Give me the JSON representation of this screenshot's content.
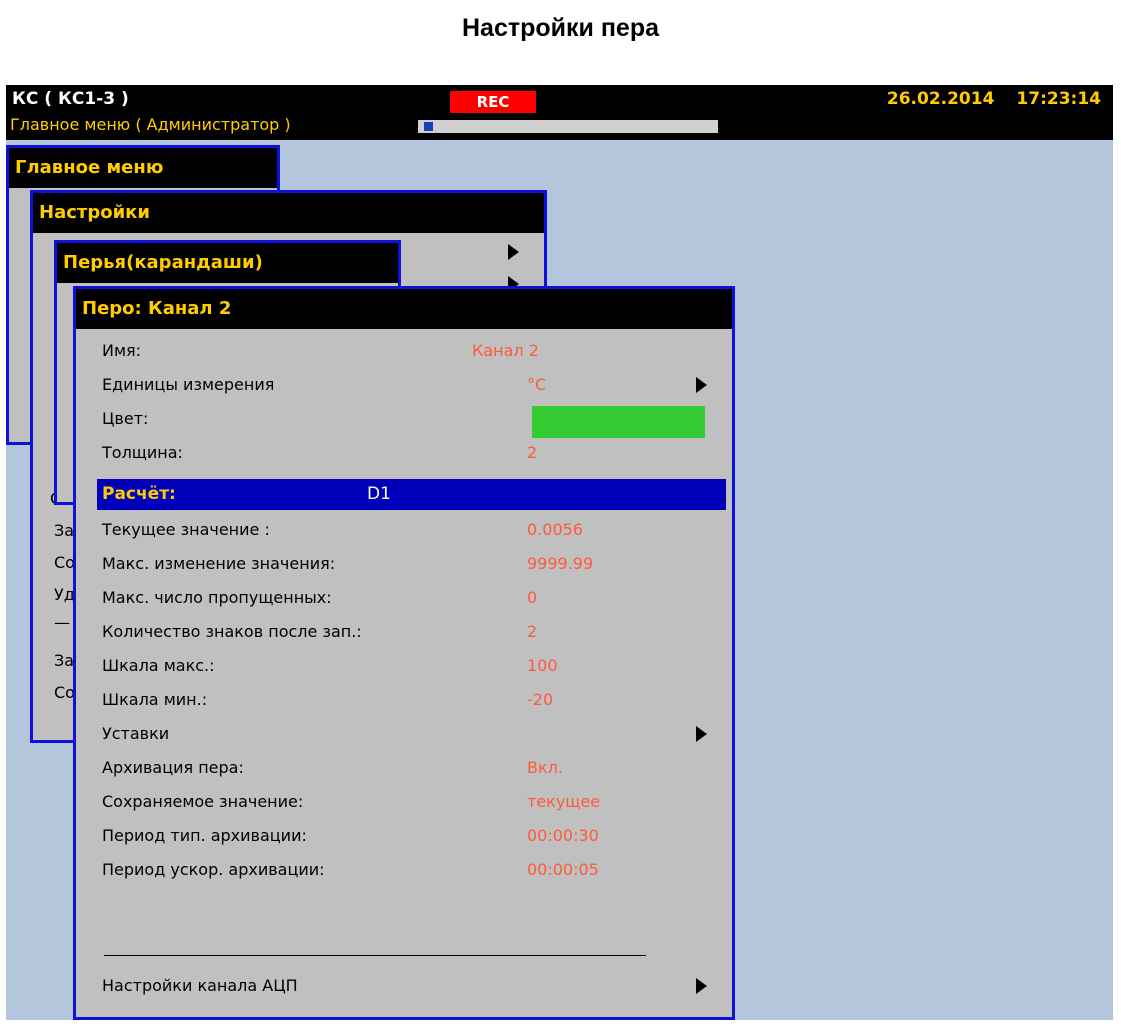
{
  "page_title": "Настройки пера",
  "header": {
    "device": "КС ( КС1-3 )",
    "menu_path": "Главное меню ( Администратор )",
    "rec": "REC",
    "date": "26.02.2014",
    "time": "17:23:14",
    "progress_fraction": 0.03
  },
  "menus": {
    "main": "Главное меню",
    "settings": "Настройки",
    "pens": "Перья(карандаши)",
    "pen_title": "Перо: Канал 2"
  },
  "stubs": [
    "С",
    "За",
    "Со",
    "Уд",
    "—",
    "За",
    "Со"
  ],
  "pen_rows": [
    {
      "label": "Имя:",
      "value": "Канал 2"
    },
    {
      "label": "Единицы измерения",
      "value": "°С"
    },
    {
      "label": "Цвет:",
      "value": ""
    },
    {
      "label": "Толщина:",
      "value": "2"
    },
    {
      "label": "Расчёт:",
      "value": "D1"
    },
    {
      "label": "Текущее значение :",
      "value": "0.0056"
    },
    {
      "label": "Макс. изменение значения:",
      "value": "9999.99"
    },
    {
      "label": "Макс. число пропущенных:",
      "value": "0"
    },
    {
      "label": "Количество знаков после зап.:",
      "value": "2"
    },
    {
      "label": "Шкала макс.:",
      "value": "100"
    },
    {
      "label": "Шкала мин.:",
      "value": "-20"
    },
    {
      "label": "Уставки",
      "value": ""
    },
    {
      "label": "Архивация пера:",
      "value": "Вкл."
    },
    {
      "label": "Сохраняемое значение:",
      "value": "текущее"
    },
    {
      "label": "Период тип. архивации:",
      "value": "00:00:30"
    },
    {
      "label": "Период ускор. архивации:",
      "value": "00:00:05"
    },
    {
      "label": "Настройки канала АЦП",
      "value": ""
    }
  ],
  "colors": {
    "accent_yellow": "#ffcc00",
    "value_red": "#ff5a3c",
    "pen_color": "#33cc33",
    "selection_blue": "#0000bb",
    "panel_border": "#1010dd",
    "background": "#b4c6dc"
  },
  "icons": {
    "submenu": "triangle-right-icon"
  }
}
